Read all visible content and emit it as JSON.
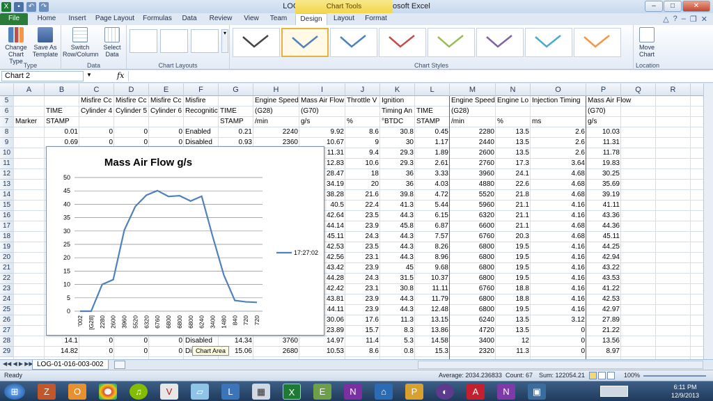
{
  "window": {
    "title": "LOG-01-016-003-002.xlsx - Microsoft Excel",
    "context_tab": "Chart Tools"
  },
  "tabs": [
    "File",
    "Home",
    "Insert",
    "Page Layout",
    "Formulas",
    "Data",
    "Review",
    "View",
    "Team",
    "Design",
    "Layout",
    "Format"
  ],
  "ribbon": {
    "type_group": {
      "label": "Type",
      "change_chart_type": "Change Chart Type",
      "save_as_template": "Save As Template"
    },
    "data_group": {
      "label": "Data",
      "switch_row_column": "Switch Row/Column",
      "select_data": "Select Data"
    },
    "layouts_group": {
      "label": "Chart Layouts"
    },
    "styles_group": {
      "label": "Chart Styles",
      "colors": [
        "#444444",
        "#4f81bd",
        "#4f81bd",
        "#c0504d",
        "#9bbb59",
        "#8064a2",
        "#4bacc6",
        "#f79646"
      ]
    },
    "location_group": {
      "label": "Location",
      "move_chart": "Move Chart"
    }
  },
  "namebox": "Chart 2",
  "fx_symbol": "fx",
  "columns": [
    "A",
    "B",
    "C",
    "D",
    "E",
    "F",
    "G",
    "H",
    "I",
    "J",
    "K",
    "L",
    "M",
    "N",
    "O",
    "P",
    "Q",
    "R",
    "S"
  ],
  "rows": [
    "5",
    "6",
    "7",
    "8",
    "9",
    "10",
    "11",
    "12",
    "13",
    "14",
    "15",
    "16",
    "17",
    "18",
    "19",
    "20",
    "21",
    "22",
    "23",
    "24",
    "25",
    "26",
    "27",
    "28",
    "29"
  ],
  "header_rows": {
    "r5": [
      "",
      "",
      "Misfire Cc",
      "Misfire Cc",
      "Misfire Cc",
      "Misfire",
      "",
      "Engine Speed",
      "Mass Air Flow",
      "Throttle V",
      "Ignition",
      "",
      "Engine Speed",
      "Engine Lo",
      "Injection Timing",
      "Mass Air Flow"
    ],
    "r6": [
      "",
      "TIME",
      "Cylinder 4",
      "Cylinder 5",
      "Cylinder 6",
      "Recognitic",
      "TIME",
      "(G28)",
      "(G70)",
      "",
      "Timing An",
      "TIME",
      "(G28)",
      "",
      "",
      "(G70)"
    ],
    "r7": [
      "Marker",
      "STAMP",
      "",
      "",
      "",
      "",
      "STAMP",
      "/min",
      "g/s",
      "%",
      "°BTDC",
      "STAMP",
      "/min",
      "%",
      "ms",
      "g/s"
    ]
  },
  "data_rows": [
    [
      "",
      "0.01",
      "0",
      "0",
      "0",
      "Enabled",
      "0.21",
      "2240",
      "9.92",
      "8.6",
      "30.8",
      "0.45",
      "2280",
      "13.5",
      "2.6",
      "10.03"
    ],
    [
      "",
      "0.69",
      "0",
      "0",
      "0",
      "Disabled",
      "0.93",
      "2360",
      "10.67",
      "9",
      "30",
      "1.17",
      "2440",
      "13.5",
      "2.6",
      "11.31"
    ],
    [
      "",
      "",
      "",
      "",
      "",
      "",
      "",
      "",
      "11.31",
      "9.4",
      "29.3",
      "1.89",
      "2600",
      "13.5",
      "2.6",
      "11.78"
    ],
    [
      "",
      "",
      "",
      "",
      "",
      "",
      "",
      "",
      "12.83",
      "10.6",
      "29.3",
      "2.61",
      "2760",
      "17.3",
      "3.64",
      "19.83"
    ],
    [
      "",
      "",
      "",
      "",
      "",
      "",
      "",
      "",
      "28.47",
      "18",
      "36",
      "3.33",
      "3960",
      "24.1",
      "4.68",
      "30.25"
    ],
    [
      "",
      "",
      "",
      "",
      "",
      "",
      "",
      "",
      "34.19",
      "20",
      "36",
      "4.03",
      "4880",
      "22.6",
      "4.68",
      "35.69"
    ],
    [
      "",
      "",
      "",
      "",
      "",
      "",
      "",
      "",
      "38.28",
      "21.6",
      "39.8",
      "4.72",
      "5520",
      "21.8",
      "4.68",
      "39.19"
    ],
    [
      "",
      "",
      "",
      "",
      "",
      "",
      "",
      "",
      "40.5",
      "22.4",
      "41.3",
      "5.44",
      "5960",
      "21.1",
      "4.16",
      "41.11"
    ],
    [
      "",
      "",
      "",
      "",
      "",
      "",
      "",
      "",
      "42.64",
      "23.5",
      "44.3",
      "6.15",
      "6320",
      "21.1",
      "4.16",
      "43.36"
    ],
    [
      "",
      "",
      "",
      "",
      "",
      "",
      "",
      "",
      "44.14",
      "23.9",
      "45.8",
      "6.87",
      "6600",
      "21.1",
      "4.68",
      "44.36"
    ],
    [
      "",
      "",
      "",
      "",
      "",
      "",
      "",
      "",
      "45.11",
      "24.3",
      "44.3",
      "7.57",
      "6760",
      "20.3",
      "4.68",
      "45.11"
    ],
    [
      "",
      "",
      "",
      "",
      "",
      "",
      "",
      "",
      "42.53",
      "23.5",
      "44.3",
      "8.26",
      "6800",
      "19.5",
      "4.16",
      "44.25"
    ],
    [
      "",
      "",
      "",
      "",
      "",
      "",
      "",
      "",
      "42.56",
      "23.1",
      "44.3",
      "8.96",
      "6800",
      "19.5",
      "4.16",
      "42.94"
    ],
    [
      "",
      "",
      "",
      "",
      "",
      "",
      "",
      "",
      "43.42",
      "23.9",
      "45",
      "9.68",
      "6800",
      "19.5",
      "4.16",
      "43.22"
    ],
    [
      "",
      "",
      "",
      "",
      "",
      "",
      "",
      "",
      "44.28",
      "24.3",
      "31.5",
      "10.37",
      "6800",
      "19.5",
      "4.16",
      "43.53"
    ],
    [
      "",
      "",
      "",
      "",
      "",
      "",
      "",
      "",
      "42.42",
      "23.1",
      "30.8",
      "11.11",
      "6760",
      "18.8",
      "4.16",
      "41.22"
    ],
    [
      "",
      "",
      "",
      "",
      "",
      "",
      "",
      "",
      "43.81",
      "23.9",
      "44.3",
      "11.79",
      "6800",
      "18.8",
      "4.16",
      "42.53"
    ],
    [
      "",
      "",
      "",
      "",
      "",
      "",
      "",
      "",
      "44.11",
      "23.9",
      "44.3",
      "12.48",
      "6800",
      "19.5",
      "4.16",
      "42.97"
    ],
    [
      "",
      "",
      "",
      "",
      "",
      "",
      "",
      "",
      "30.06",
      "17.6",
      "11.3",
      "13.15",
      "6240",
      "13.5",
      "3.12",
      "27.89"
    ],
    [
      "",
      "",
      "",
      "",
      "",
      "",
      "",
      "",
      "23.89",
      "15.7",
      "8.3",
      "13.86",
      "4720",
      "13.5",
      "0",
      "21.22"
    ],
    [
      "",
      "14.1",
      "0",
      "0",
      "0",
      "Disabled",
      "14.34",
      "3760",
      "14.97",
      "11.4",
      "5.3",
      "14.58",
      "3400",
      "12",
      "0",
      "13.56"
    ],
    [
      "",
      "14.82",
      "0",
      "0",
      "0",
      "Di",
      "15.06",
      "2680",
      "10.53",
      "8.6",
      "0.8",
      "15.3",
      "2320",
      "11.3",
      "0",
      "8.97"
    ]
  ],
  "chart_data": {
    "type": "line",
    "title": "Mass Air Flow g/s",
    "categories": [
      "'002",
      "[G28]",
      "2280",
      "2600",
      "3960",
      "5520",
      "6320",
      "6760",
      "6800",
      "6800",
      "6800",
      "6240",
      "3400",
      "1480",
      "840",
      "720",
      "720"
    ],
    "series": [
      {
        "name": "17:27:02",
        "values": [
          0,
          0,
          10,
          11.8,
          30.3,
          39.2,
          43.4,
          45.1,
          42.9,
          43.2,
          41.2,
          43,
          27.9,
          13.6,
          4,
          3.5,
          3.3
        ],
        "color": "#4f81bd"
      }
    ],
    "ylim": [
      0,
      50
    ],
    "yticks": [
      0,
      5,
      10,
      15,
      20,
      25,
      30,
      35,
      40,
      45,
      50
    ],
    "grid": true,
    "legend": "right"
  },
  "tooltip": "Chart Area",
  "sheet_tab": "LOG-01-016-003-002",
  "status": {
    "ready": "Ready",
    "average": "Average: 2034.236833",
    "count": "Count: 67",
    "sum": "Sum: 122054.21",
    "zoom": "100%"
  },
  "taskbar": {
    "time": "6:11 PM",
    "date": "12/9/2013"
  }
}
